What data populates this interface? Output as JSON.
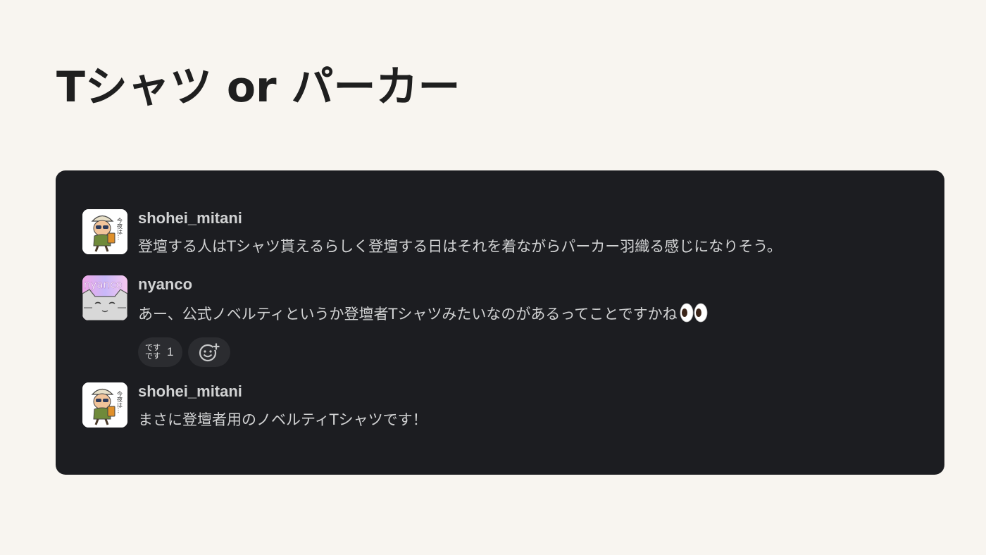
{
  "page": {
    "title": "Tシャツ or パーカー"
  },
  "colors": {
    "background": "#f8f5f0",
    "panel": "#1c1d21",
    "text": "#d1d2d3",
    "reaction_pill": "#2b2c30"
  },
  "messages": [
    {
      "username": "shohei_mitani",
      "avatar_icon": "cartoon-explorer-avatar",
      "avatar_text": "今夜は…",
      "text": "登壇する人はTシャツ貰えるらしく登壇する日はそれを着ながらパーカー羽織る感じになりそう。"
    },
    {
      "username": "nyanco",
      "avatar_icon": "cat-avatar",
      "avatar_text": "nyanco",
      "text": "あー、公式ノベルティというか登壇者Tシャツみたいなのがあるってことですかね",
      "trailing_emoji": "eyes-emoji",
      "reactions": [
        {
          "emoji_line1": "です",
          "emoji_line2": "です",
          "count": "1"
        }
      ],
      "add_reaction_icon": "add-reaction-icon"
    },
    {
      "username": "shohei_mitani",
      "avatar_icon": "cartoon-explorer-avatar",
      "avatar_text": "今夜は…",
      "text": "まさに登壇者用のノベルティTシャツです！"
    }
  ]
}
